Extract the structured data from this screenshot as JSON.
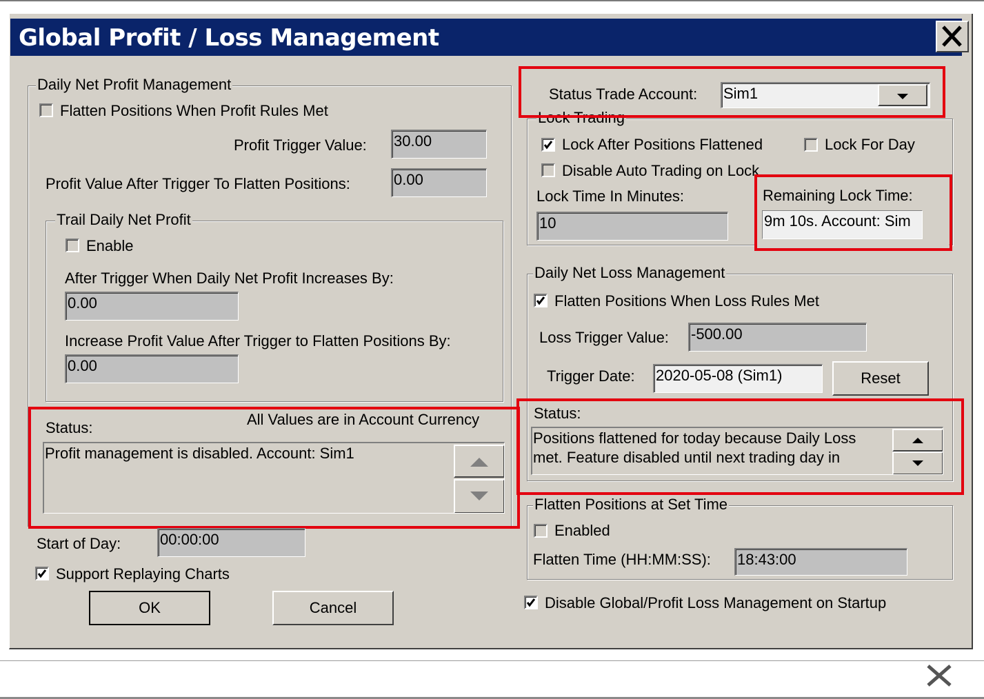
{
  "dialog": {
    "title": "Global Profit / Loss Management",
    "close_icon": "close-icon"
  },
  "profit": {
    "group_title": "Daily Net Profit Management",
    "flatten_label": "Flatten Positions When Profit Rules Met",
    "flatten_checked": false,
    "trigger_label": "Profit Trigger Value:",
    "trigger_value": "30.00",
    "after_label": "Profit Value After Trigger To Flatten Positions:",
    "after_value": "0.00"
  },
  "trail": {
    "group_title": "Trail Daily Net Profit",
    "enable_label": "Enable",
    "enable_checked": false,
    "increase_label": "After Trigger When Daily Net Profit Increases By:",
    "increase_value": "0.00",
    "flatten_by_label": "Increase Profit Value After Trigger to Flatten Positions By:",
    "flatten_by_value": "0.00"
  },
  "profit_status": {
    "label": "Status:",
    "currency_note": "All Values are in Account Currency",
    "text": "Profit management is disabled. Account: Sim1"
  },
  "start_of_day": {
    "label": "Start of Day:",
    "value": "00:00:00"
  },
  "replay": {
    "label": "Support Replaying Charts",
    "checked": true
  },
  "buttons": {
    "ok": "OK",
    "cancel": "Cancel",
    "reset": "Reset"
  },
  "account": {
    "label": "Status Trade Account:",
    "value": "Sim1"
  },
  "lock": {
    "group_title": "Lock Trading",
    "after_flatten_label": "Lock After Positions Flattened",
    "after_flatten_checked": true,
    "for_day_label": "Lock For Day",
    "for_day_checked": false,
    "disable_auto_label": "Disable Auto Trading on Lock",
    "disable_auto_checked": false,
    "minutes_label": "Lock Time In Minutes:",
    "minutes_value": "10",
    "remaining_label": "Remaining Lock Time:",
    "remaining_value": "9m 10s. Account: Sim"
  },
  "loss": {
    "group_title": "Daily Net Loss Management",
    "flatten_label": "Flatten Positions When Loss Rules Met",
    "flatten_checked": true,
    "trigger_label": "Loss Trigger Value:",
    "trigger_value": "-500.00",
    "date_label": "Trigger Date:",
    "date_value": "2020-05-08 (Sim1)",
    "status_label": "Status:",
    "status_line1": "Positions flattened for today because Daily Loss",
    "status_line2": "met. Feature disabled until next trading day in"
  },
  "set_time": {
    "group_title": "Flatten Positions at Set Time",
    "enabled_label": "Enabled",
    "enabled_checked": false,
    "time_label": "Flatten Time (HH:MM:SS):",
    "time_value": "18:43:00"
  },
  "startup": {
    "label": "Disable Global/Profit Loss Management on Startup",
    "checked": true
  },
  "colors": {
    "titlebar": "#0a246a",
    "face": "#d4d0c8",
    "highlight": "#e3000f"
  }
}
